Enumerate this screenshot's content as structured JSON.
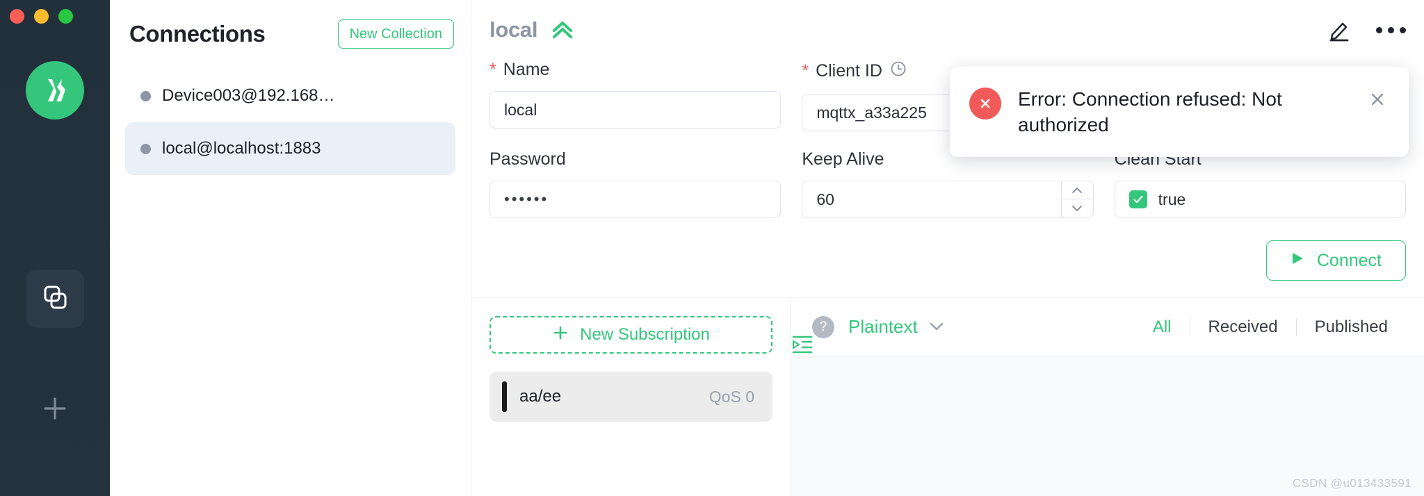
{
  "window": {
    "traffic_lights": [
      "close",
      "minimize",
      "maximize"
    ]
  },
  "rail": {
    "logo_name": "mqttx-logo",
    "items": [
      {
        "name": "connections-rail-button",
        "icon": "overlapping-squares-icon",
        "active": true
      },
      {
        "name": "add-rail-button",
        "icon": "plus-icon",
        "active": false
      }
    ]
  },
  "connections": {
    "title": "Connections",
    "new_collection_label": "New Collection",
    "items": [
      {
        "label": "Device003@192.168…",
        "selected": false,
        "status_color": "#8d96a8"
      },
      {
        "label": "local@localhost:1883",
        "selected": true,
        "status_color": "#8d96a8"
      }
    ]
  },
  "main": {
    "title": "local",
    "collapse_icon": "double-chevron-up-icon",
    "edit_icon": "pencil-icon",
    "more_icon": "ellipsis-icon"
  },
  "form": {
    "name": {
      "label": "Name",
      "required": true,
      "value": "local"
    },
    "client_id": {
      "label": "Client ID",
      "required": true,
      "value": "mqttx_a33a225",
      "icon": "clock-icon"
    },
    "password": {
      "label": "Password",
      "required": false,
      "value": "••••••"
    },
    "keep_alive": {
      "label": "Keep Alive",
      "required": false,
      "value": "60"
    },
    "clean_start": {
      "label": "Clean Start",
      "required": false,
      "value": "true",
      "checked": true
    }
  },
  "connect_button": {
    "label": "Connect",
    "icon": "play-icon"
  },
  "subscriptions": {
    "new_label": "New Subscription",
    "collapse_icon": "collapse-left-icon",
    "items": [
      {
        "topic": "aa/ee",
        "qos": "QoS 0",
        "color": "#1b1b1b"
      }
    ]
  },
  "messages": {
    "help_icon": "question-mark-icon",
    "format_label": "Plaintext",
    "format_caret": "chevron-down-icon",
    "filters": [
      {
        "label": "All",
        "active": true
      },
      {
        "label": "Received",
        "active": false
      },
      {
        "label": "Published",
        "active": false
      }
    ]
  },
  "toast": {
    "icon": "error-circle-icon",
    "message": "Error: Connection refused: Not authorized",
    "close_icon": "close-icon",
    "accent_color": "#f25a5a"
  },
  "watermark": "CSDN @u013433591",
  "theme": {
    "accent": "#34c77b",
    "rail_bg": "#22303c",
    "selected_bg": "#eaf0f8",
    "error": "#f25a5a"
  }
}
